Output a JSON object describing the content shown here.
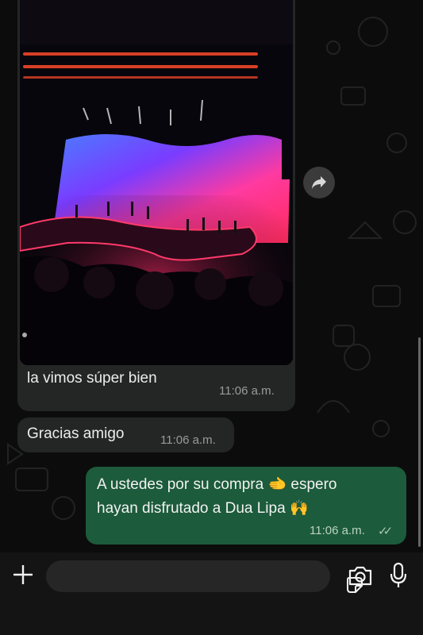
{
  "messages": {
    "received_media": {
      "caption": "la vimos súper bien",
      "time": "11:06 a.m."
    },
    "received_text": {
      "text": "Gracias amigo",
      "time": "11:06 a.m."
    },
    "sent_text": {
      "line1": "A ustedes por su compra 🫲 espero",
      "line2": "hayan disfrutado a Dua Lipa 🙌",
      "time": "11:06 a.m.",
      "status": "✓✓"
    }
  },
  "icons": {
    "forward": "forward-icon",
    "attach": "plus-icon",
    "sticker": "sticker-icon",
    "camera": "camera-icon",
    "microphone": "microphone-icon"
  },
  "colors": {
    "background": "#0c0c0c",
    "incoming_bubble": "#242626",
    "outgoing_bubble": "#1c5b3b"
  }
}
